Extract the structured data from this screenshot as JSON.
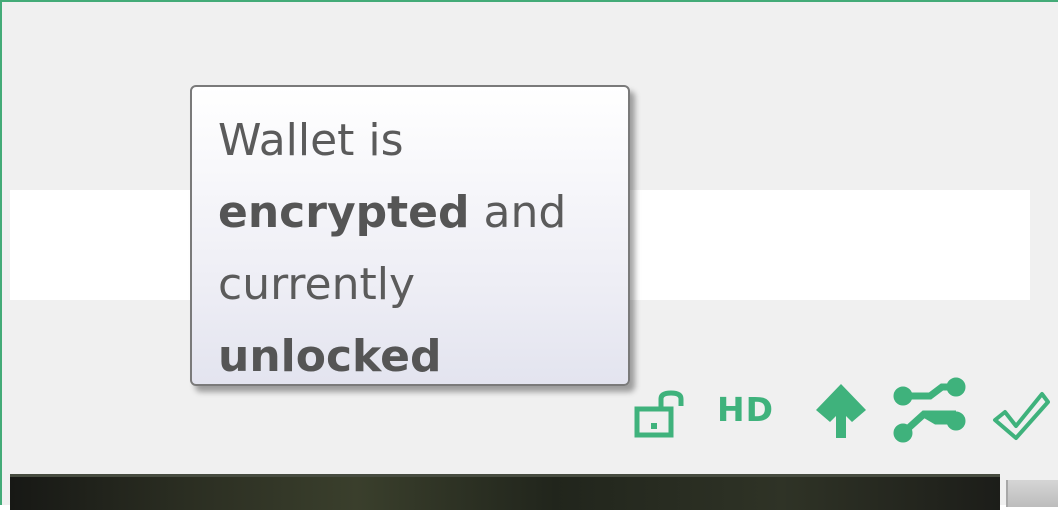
{
  "tooltip": {
    "line1": "Wallet is",
    "line2_bold": "encrypted",
    "line2_rest": " and",
    "line3": "currently",
    "line4_bold": "unlocked"
  },
  "statusbar": {
    "hd_label": "HD",
    "icons": [
      "unlocked-lock-icon",
      "hd-wallet-label",
      "staking-icon",
      "network-connections-icon",
      "synced-check-icon"
    ],
    "accent_color": "#3fb27c"
  }
}
